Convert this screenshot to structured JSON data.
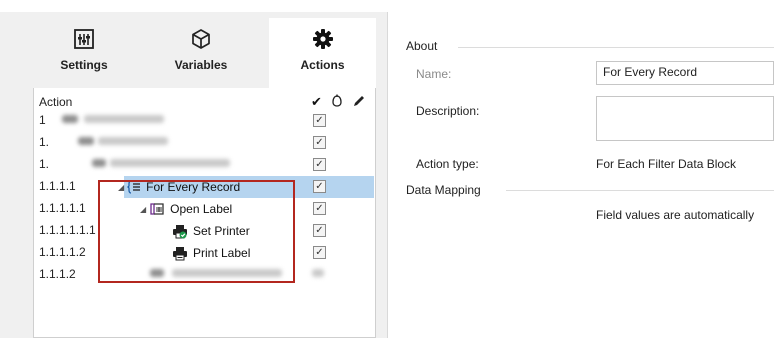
{
  "tabs": [
    {
      "label": "Settings",
      "icon": "settings-sliders-icon"
    },
    {
      "label": "Variables",
      "icon": "cube-icon"
    },
    {
      "label": "Actions",
      "icon": "gear-icon",
      "active": true
    }
  ],
  "tree": {
    "header": {
      "action": "Action",
      "check_symbol": "✔",
      "run_icon": "run-icon",
      "edit_icon": "pencil-icon"
    },
    "rows": [
      {
        "num": "1",
        "label": "",
        "checked": true
      },
      {
        "num": "1.",
        "label": "",
        "checked": true
      },
      {
        "num": "1.",
        "label": "",
        "checked": true
      },
      {
        "num": "1.1.1.1",
        "label": "For Every Record",
        "checked": true,
        "selected": true,
        "icon": "for-each-icon"
      },
      {
        "num": "1.1.1.1.1",
        "label": "Open Label",
        "checked": true,
        "icon": "open-label-icon"
      },
      {
        "num": "1.1.1.1.1.1",
        "label": "Set Printer",
        "checked": true,
        "icon": "set-printer-icon"
      },
      {
        "num": "1.1.1.1.2",
        "label": "Print Label",
        "checked": true,
        "icon": "print-label-icon"
      },
      {
        "num": "1.1.1.2",
        "label": "",
        "checked": false
      }
    ],
    "check_mark": "✓"
  },
  "about": {
    "section_title": "About",
    "name_label": "Name:",
    "name_value": "For Every Record",
    "description_label": "Description:",
    "description_value": "",
    "action_type_label": "Action type:",
    "action_type_value": "For Each Filter Data Block"
  },
  "data_mapping": {
    "section_title": "Data Mapping",
    "text": "Field values are automatically"
  },
  "colors": {
    "selection": "#b5d4ef",
    "highlight_box": "#b3271f",
    "panel_bg": "#f0f0f0"
  }
}
